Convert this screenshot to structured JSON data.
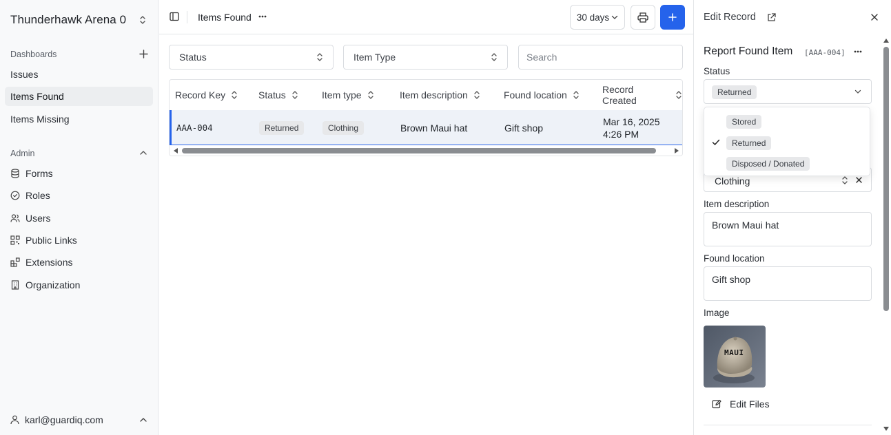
{
  "sidebar": {
    "workspace": "Thunderhawk Arena 0",
    "dashboards_label": "Dashboards",
    "nav": [
      {
        "label": "Issues"
      },
      {
        "label": "Items Found"
      },
      {
        "label": "Items Missing"
      }
    ],
    "admin_label": "Admin",
    "admin": [
      {
        "label": "Forms",
        "icon": "database-icon"
      },
      {
        "label": "Roles",
        "icon": "check-circle-icon"
      },
      {
        "label": "Users",
        "icon": "users-icon"
      },
      {
        "label": "Public Links",
        "icon": "qr-code-icon"
      },
      {
        "label": "Extensions",
        "icon": "blocks-icon"
      },
      {
        "label": "Organization",
        "icon": "building-icon"
      }
    ],
    "user_email": "karl@guardiq.com"
  },
  "header": {
    "title": "Items Found",
    "range": "30 days"
  },
  "filters": {
    "status": "Status",
    "item_type": "Item Type",
    "search_placeholder": "Search"
  },
  "table": {
    "columns": [
      "Record Key",
      "Status",
      "Item type",
      "Item description",
      "Found location",
      "Record Created"
    ],
    "rows": [
      {
        "record_key": "AAA-004",
        "status": "Returned",
        "item_type": "Clothing",
        "description": "Brown Maui hat",
        "location": "Gift shop",
        "created_date": "Mar 16, 2025",
        "created_time": "4:26 PM"
      }
    ]
  },
  "panel": {
    "title": "Edit Record",
    "form_title": "Report Found Item",
    "record_key": "[AAA-004]",
    "status_label": "Status",
    "status_value": "Returned",
    "status_options": [
      "Stored",
      "Returned",
      "Disposed / Donated"
    ],
    "selected_option": "Returned",
    "item_type_value": "Clothing",
    "description_label": "Item description",
    "description_value": "Brown Maui hat",
    "location_label": "Found location",
    "location_value": "Gift shop",
    "image_label": "Image",
    "image_text": "MAUI",
    "edit_files": "Edit Files"
  },
  "colors": {
    "accent": "#2563eb",
    "row_highlight": "#eef2f8"
  }
}
